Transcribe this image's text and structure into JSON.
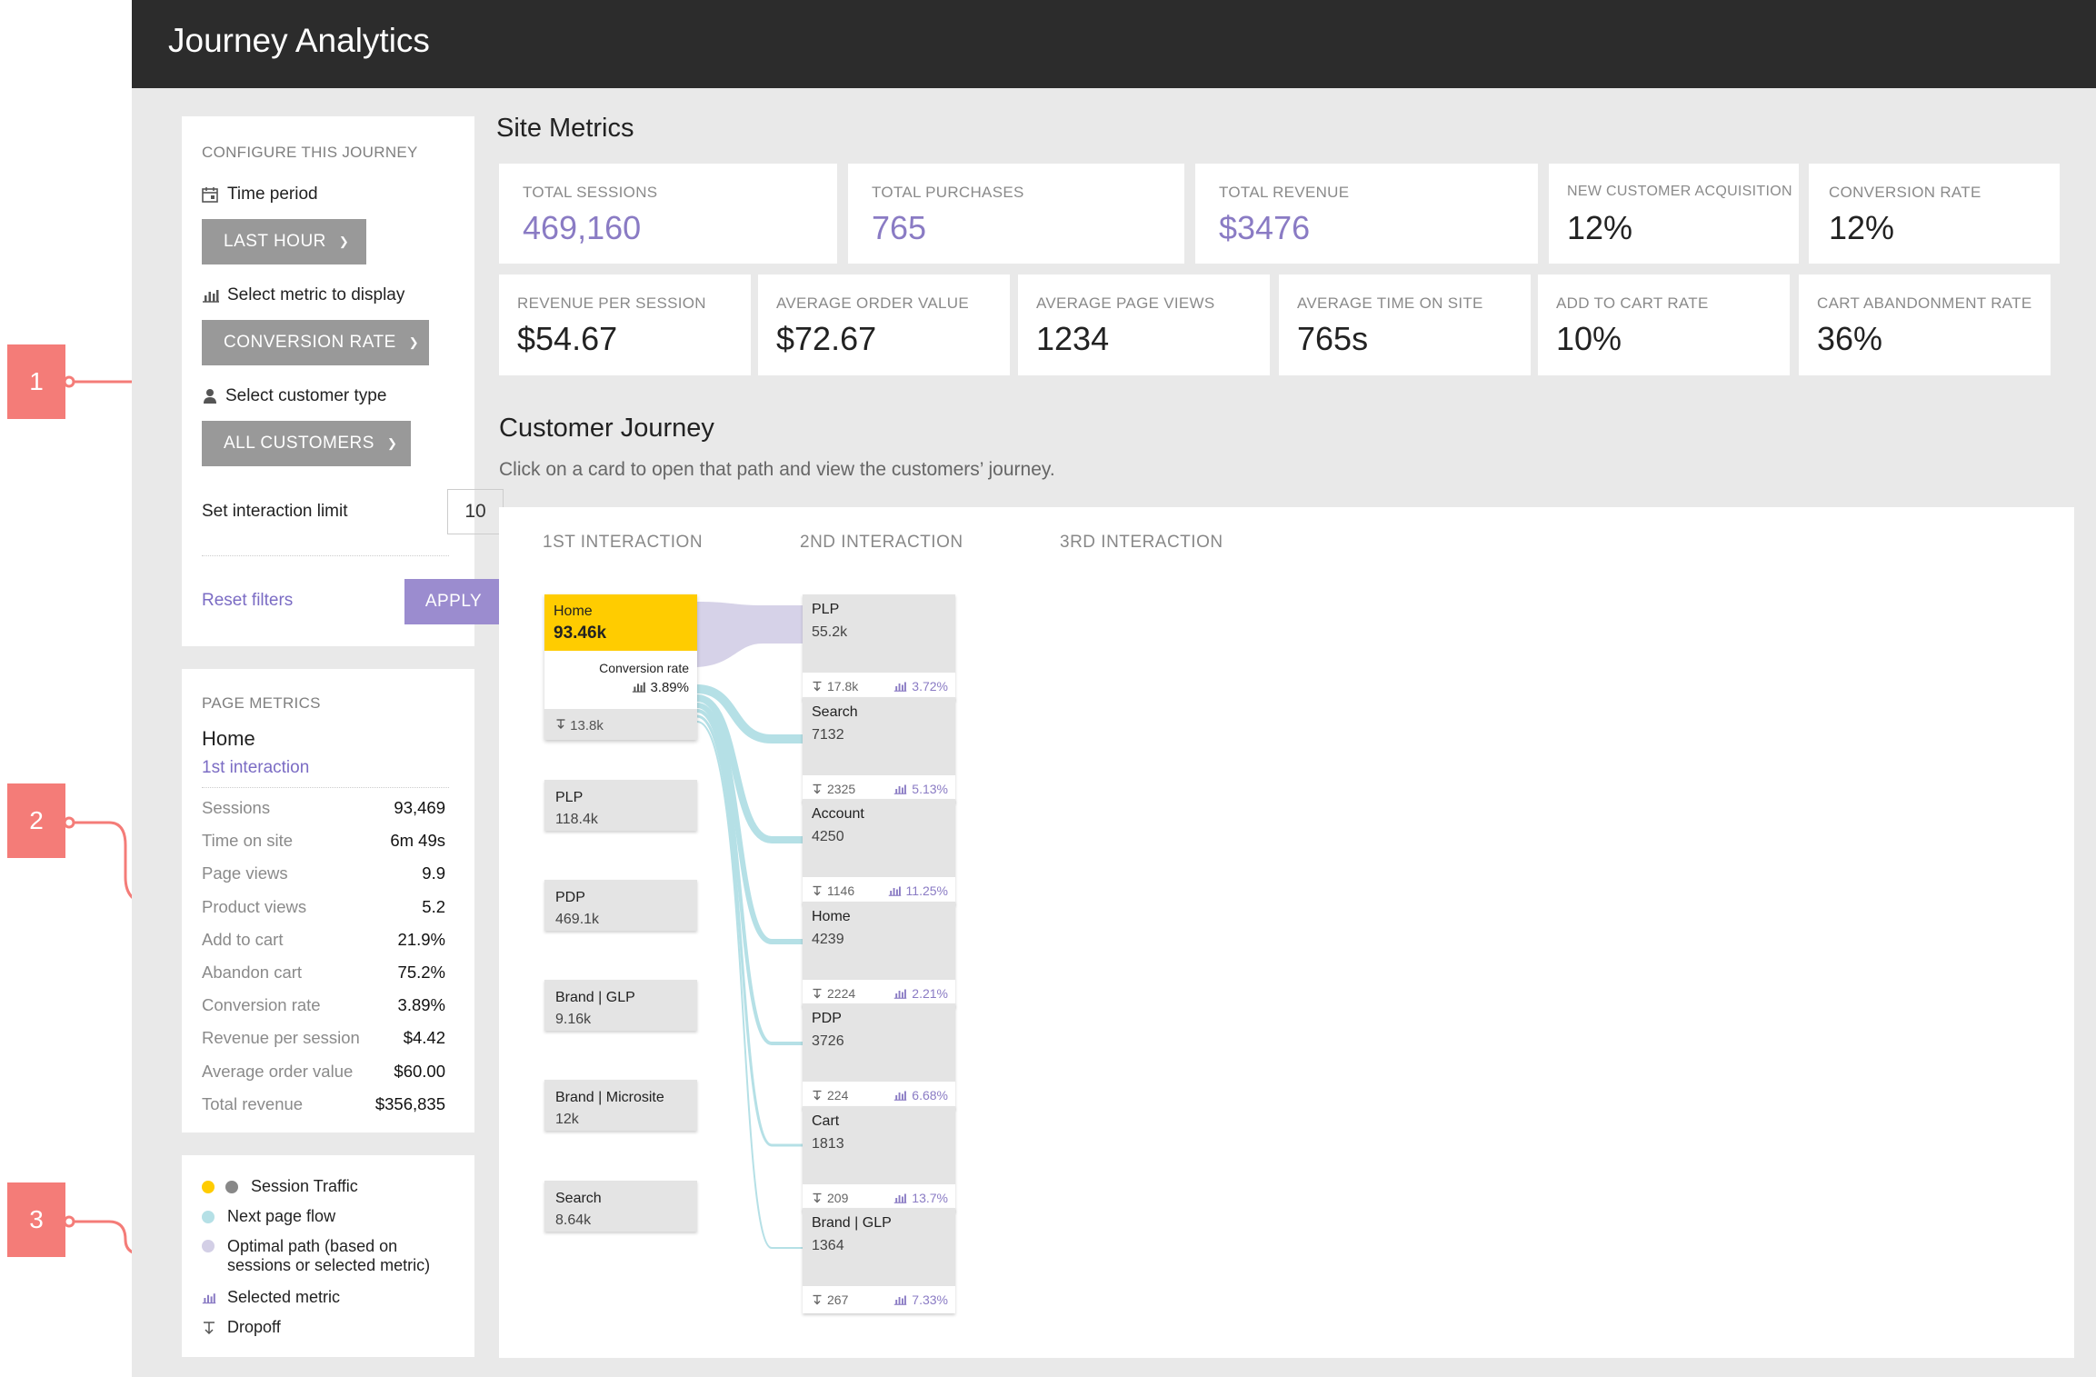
{
  "app": {
    "title": "Journey Analytics"
  },
  "callouts": [
    "1",
    "2",
    "3"
  ],
  "configure": {
    "heading": "CONFIGURE THIS JOURNEY",
    "time_period_label": "Time period",
    "time_period_value": "LAST HOUR",
    "metric_label": "Select metric to display",
    "metric_value": "CONVERSION RATE",
    "customer_label": "Select customer type",
    "customer_value": "ALL CUSTOMERS",
    "limit_label": "Set interaction limit",
    "limit_value": "10",
    "reset_label": "Reset filters",
    "apply_label": "APPLY"
  },
  "page_metrics": {
    "heading": "PAGE METRICS",
    "page": "Home",
    "interaction": "1st interaction",
    "rows": [
      {
        "label": "Sessions",
        "value": "93,469"
      },
      {
        "label": "Time on site",
        "value": "6m 49s"
      },
      {
        "label": "Page views",
        "value": "9.9"
      },
      {
        "label": "Product views",
        "value": "5.2"
      },
      {
        "label": "Add to cart",
        "value": "21.9%"
      },
      {
        "label": "Abandon cart",
        "value": "75.2%"
      },
      {
        "label": "Conversion rate",
        "value": "3.89%"
      },
      {
        "label": "Revenue per session",
        "value": "$4.42"
      },
      {
        "label": "Average order value",
        "value": "$60.00"
      },
      {
        "label": "Total revenue",
        "value": "$356,835"
      }
    ]
  },
  "legend": {
    "session_traffic": "Session Traffic",
    "next_page_flow": "Next page flow",
    "optimal_path_1": "Optimal path (based on",
    "optimal_path_2": "sessions or selected metric)",
    "selected_metric": "Selected metric",
    "dropoff": "Dropoff"
  },
  "colors": {
    "accent": "#8a7bc4",
    "yellow": "#ffcc00",
    "teal": "#b5e0e6",
    "lavender": "#d3cfe6"
  },
  "site_metrics": {
    "title": "Site Metrics",
    "row1": [
      {
        "label": "TOTAL SESSIONS",
        "value": "469,160"
      },
      {
        "label": "TOTAL PURCHASES",
        "value": "765"
      },
      {
        "label": "TOTAL REVENUE",
        "value": "$3476"
      },
      {
        "label": "NEW CUSTOMER ACQUISITION",
        "value": "12%"
      },
      {
        "label": "CONVERSION RATE",
        "value": "12%"
      }
    ],
    "row2": [
      {
        "label": "REVENUE PER SESSION",
        "value": "$54.67"
      },
      {
        "label": "AVERAGE ORDER VALUE",
        "value": "$72.67"
      },
      {
        "label": "AVERAGE PAGE VIEWS",
        "value": "1234"
      },
      {
        "label": "AVERAGE TIME ON SITE",
        "value": "765s"
      },
      {
        "label": "ADD TO CART RATE",
        "value": "10%"
      },
      {
        "label": "CART ABANDONMENT RATE",
        "value": "36%"
      }
    ]
  },
  "journey": {
    "title": "Customer Journey",
    "subtitle": "Click on a card to open that path and view the customers’ journey.",
    "columns": [
      "1ST INTERACTION",
      "2ND INTERACTION",
      "3RD INTERACTION"
    ],
    "home": {
      "name": "Home",
      "value": "93.46k",
      "metric_label": "Conversion rate",
      "metric_value": "3.89%",
      "dropoff": "13.8k"
    },
    "first": [
      {
        "name": "PLP",
        "value": "118.4k"
      },
      {
        "name": "PDP",
        "value": "469.1k"
      },
      {
        "name": "Brand | GLP",
        "value": "9.16k"
      },
      {
        "name": "Brand | Microsite",
        "value": "12k"
      },
      {
        "name": "Search",
        "value": "8.64k"
      }
    ],
    "second": [
      {
        "name": "PLP",
        "value": "55.2k",
        "dropoff": "17.8k",
        "metric": "3.72%"
      },
      {
        "name": "Search",
        "value": "7132",
        "dropoff": "2325",
        "metric": "5.13%"
      },
      {
        "name": "Account",
        "value": "4250",
        "dropoff": "1146",
        "metric": "11.25%"
      },
      {
        "name": "Home",
        "value": "4239",
        "dropoff": "2224",
        "metric": "2.21%"
      },
      {
        "name": "PDP",
        "value": "3726",
        "dropoff": "224",
        "metric": "6.68%"
      },
      {
        "name": "Cart",
        "value": "1813",
        "dropoff": "209",
        "metric": "13.7%"
      },
      {
        "name": "Brand | GLP",
        "value": "1364",
        "dropoff": "267",
        "metric": "7.33%"
      }
    ]
  }
}
